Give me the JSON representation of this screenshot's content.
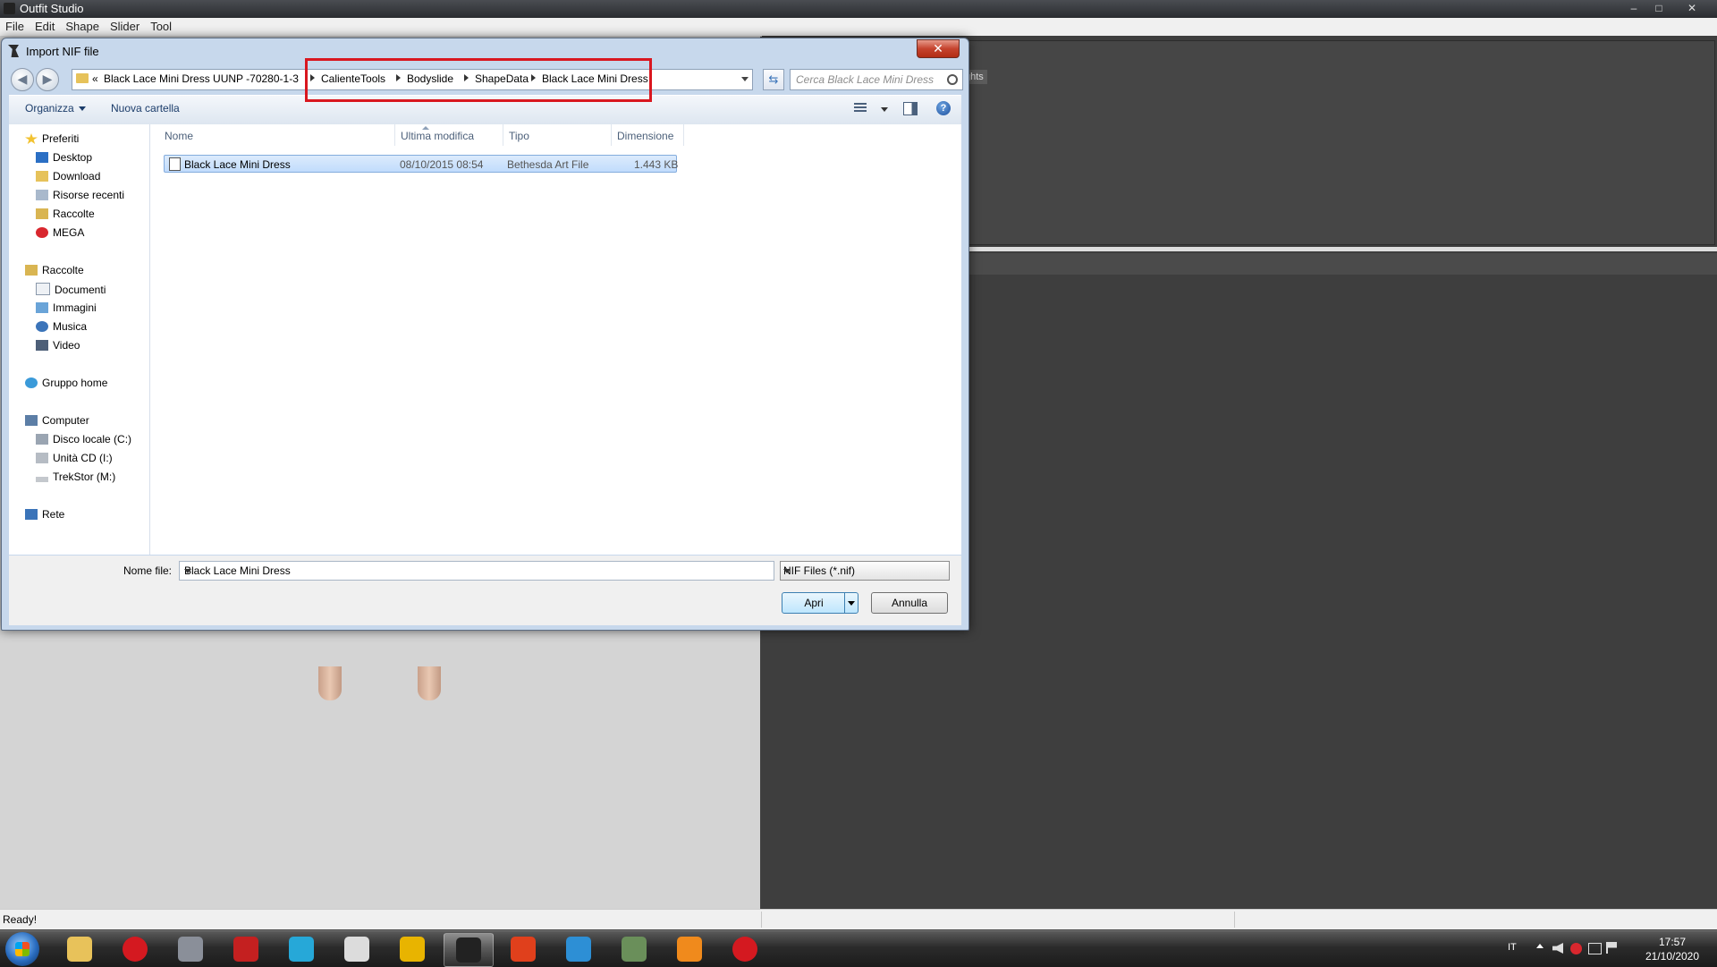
{
  "app": {
    "title": "Outfit Studio",
    "menu": [
      "File",
      "Edit",
      "Shape",
      "Slider",
      "Tool"
    ],
    "window_controls": [
      "–",
      "□",
      "✕"
    ],
    "lights_tab": "ghts",
    "status": "Ready!"
  },
  "dialog": {
    "title": "Import NIF file",
    "close_glyph": "✕",
    "nav": {
      "back": "◀",
      "forward": "▶"
    },
    "breadcrumb": {
      "overflow": "«",
      "items": [
        "Black Lace Mini Dress UUNP -70280-1-3",
        "CalienteTools",
        "Bodyslide",
        "ShapeData",
        "Black Lace Mini Dress"
      ]
    },
    "refresh_glyph": "⇆",
    "search_placeholder": "Cerca Black Lace Mini Dress",
    "toolbar": {
      "organize": "Organizza",
      "new_folder": "Nuova cartella",
      "help": "?"
    },
    "nav_pane": {
      "favorites": {
        "label": "Preferiti",
        "items": [
          "Desktop",
          "Download",
          "Risorse recenti",
          "Raccolte",
          "MEGA"
        ]
      },
      "libraries": {
        "label": "Raccolte",
        "items": [
          "Documenti",
          "Immagini",
          "Musica",
          "Video"
        ]
      },
      "homegroup": "Gruppo home",
      "computer": {
        "label": "Computer",
        "items": [
          "Disco locale (C:)",
          "Unità CD (I:)",
          "TrekStor (M:)"
        ]
      },
      "network": "Rete"
    },
    "columns": [
      "Nome",
      "Ultima modifica",
      "Tipo",
      "Dimensione"
    ],
    "files": [
      {
        "name": "Black Lace Mini Dress",
        "modified": "08/10/2015 08:54",
        "type": "Bethesda Art File",
        "size": "1.443 KB"
      }
    ],
    "filename_label": "Nome file:",
    "filename_value": "Black Lace Mini Dress",
    "filter_value": "NIF Files (*.nif)",
    "open_button": "Apri",
    "cancel_button": "Annulla"
  },
  "taskbar": {
    "apps": [
      {
        "name": "explorer",
        "color": "#e8c25a"
      },
      {
        "name": "opera",
        "color": "#d41920"
      },
      {
        "name": "media",
        "color": "#8a8f99"
      },
      {
        "name": "gear-app",
        "color": "#c42020"
      },
      {
        "name": "music",
        "color": "#26a8d8"
      },
      {
        "name": "audio",
        "color": "#dcdcdc"
      },
      {
        "name": "cpu-app",
        "color": "#e8b400"
      },
      {
        "name": "outfit-studio",
        "color": "#222222"
      },
      {
        "name": "foxit",
        "color": "#e0401c"
      },
      {
        "name": "ffdec",
        "color": "#2d8fd5"
      },
      {
        "name": "window-app",
        "color": "#6a8f5a"
      },
      {
        "name": "cross-app",
        "color": "#f08a1c"
      },
      {
        "name": "opera-2",
        "color": "#d41920"
      }
    ],
    "tray": {
      "lang": "IT",
      "time": "17:57",
      "date": "21/10/2020"
    }
  }
}
